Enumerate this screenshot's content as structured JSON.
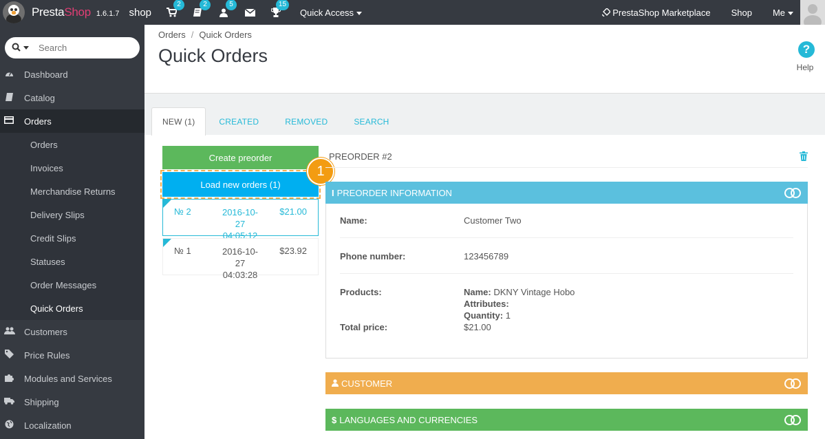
{
  "topbar": {
    "brand_presta": "Presta",
    "brand_shop": "Shop",
    "version": "1.6.1.7",
    "store_name": "shop",
    "badges": {
      "orders": "2",
      "messages": "2",
      "customers": "5",
      "trophy": "15"
    },
    "quick_access": "Quick Access",
    "marketplace": "PrestaShop Marketplace",
    "shop": "Shop",
    "me": "Me"
  },
  "sidebar": {
    "search_placeholder": "Search",
    "items": [
      {
        "label": "Dashboard",
        "icon": "dashboard-icon"
      },
      {
        "label": "Catalog",
        "icon": "book-icon"
      },
      {
        "label": "Orders",
        "icon": "credit-card-icon"
      },
      {
        "label": "Customers",
        "icon": "users-icon"
      },
      {
        "label": "Price Rules",
        "icon": "tags-icon"
      },
      {
        "label": "Modules and Services",
        "icon": "puzzle-icon"
      },
      {
        "label": "Shipping",
        "icon": "truck-icon"
      },
      {
        "label": "Localization",
        "icon": "globe-icon"
      }
    ],
    "orders_sub": [
      "Orders",
      "Invoices",
      "Merchandise Returns",
      "Delivery Slips",
      "Credit Slips",
      "Statuses",
      "Order Messages",
      "Quick Orders"
    ]
  },
  "header": {
    "breadcrumb_parent": "Orders",
    "breadcrumb_sep": "/",
    "breadcrumb_current": "Quick Orders",
    "title": "Quick Orders",
    "help": "Help"
  },
  "tabs": [
    "NEW (1)",
    "CREATED",
    "REMOVED",
    "SEARCH"
  ],
  "left": {
    "create_button": "Create preorder",
    "load_button": "Load new orders (1)",
    "step_number": "1",
    "orders": [
      {
        "num": "№ 2",
        "date": "2016-10-27",
        "time": "04:05:12",
        "amount": "$21.00"
      },
      {
        "num": "№ 1",
        "date": "2016-10-27",
        "time": "04:03:28",
        "amount": "$23.92"
      }
    ]
  },
  "preorder": {
    "title": "PREORDER #2",
    "info_title": "PREORDER INFORMATION",
    "name_label": "Name:",
    "name_value": "Customer Two",
    "phone_label": "Phone number:",
    "phone_value": "123456789",
    "products_label": "Products:",
    "product_name_key": "Name:",
    "product_name": "DKNY Vintage Hobo",
    "attributes_key": "Attributes:",
    "quantity_key": "Quantity:",
    "quantity": "1",
    "total_label": "Total price:",
    "total_value": "$21.00",
    "customer_title": "CUSTOMER",
    "lang_title": "LANGUAGES AND CURRENCIES"
  },
  "colors": {
    "accent": "#25b9d7",
    "sidebar_bg": "#363a41",
    "green": "#5cb85c",
    "blue_button": "#00aff0",
    "info_bar": "#5bc0de",
    "orange": "#f0ad4e"
  }
}
